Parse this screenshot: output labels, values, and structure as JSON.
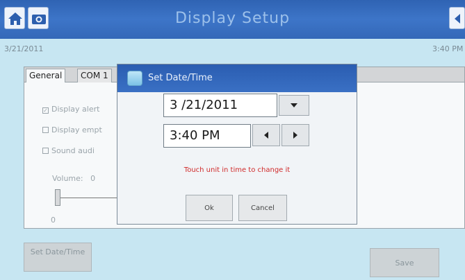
{
  "window": {
    "title": "Display Setup"
  },
  "status": {
    "date": "3/21/2011",
    "time": "3:40 PM"
  },
  "tabs": [
    {
      "label": "General"
    },
    {
      "label": "COM 1"
    }
  ],
  "options": [
    {
      "label": "Display alert",
      "checked": true
    },
    {
      "label": "Display empt",
      "checked": false
    },
    {
      "label": "Sound audi",
      "checked": false
    }
  ],
  "volume": {
    "label": "Volume:",
    "value": "0",
    "min_label": "0"
  },
  "buttons": {
    "set_date_time": "Set Date/Time",
    "save": "Save"
  },
  "dialog": {
    "title": "Set Date/Time",
    "date_value": "3 /21/2011",
    "time_value": "3:40 PM",
    "hint": "Touch unit in time to change it",
    "ok": "Ok",
    "cancel": "Cancel"
  },
  "colors": {
    "titlebar": "#3468b8",
    "background": "#c7e6f2",
    "hint": "#d02a2a"
  },
  "icons": [
    "home-icon",
    "camera-icon",
    "back-icon",
    "calendar-icon",
    "chevron-down-icon",
    "arrow-left-icon",
    "arrow-right-icon"
  ]
}
